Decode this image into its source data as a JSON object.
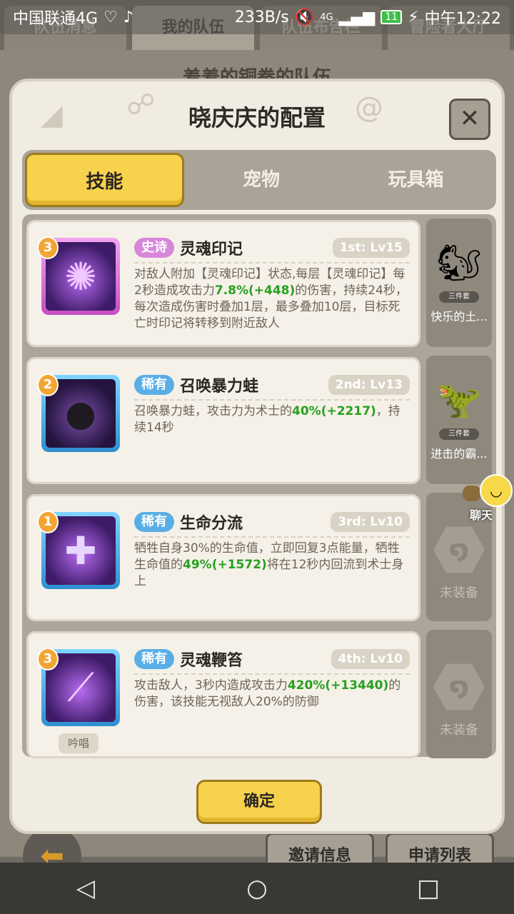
{
  "status_bar": {
    "carrier": "中国联通4G",
    "speed": "233B/s",
    "network": "4G",
    "battery": "11",
    "time": "中午12:22"
  },
  "background": {
    "tabs": [
      "队伍消息",
      "我的队伍",
      "队伍布告栏",
      "冒险者大厅"
    ],
    "team_title": "羞羞的铜拳的队伍",
    "invite_button": "邀请信息",
    "apply_button": "申请列表"
  },
  "modal": {
    "title": "晓庆庆的配置",
    "tabs": [
      "技能",
      "宠物",
      "玩具箱"
    ],
    "confirm_label": "确定",
    "skills": [
      {
        "order": "3",
        "rarity": "史诗",
        "name": "灵魂印记",
        "level": "1st: Lv15",
        "desc_a": "对敌人附加【灵魂印记】状态,每层【灵魂印记】每2秒造成攻击力",
        "g1": "7.8%(+448)",
        "desc_b": "的伤害，持续24秒，每次造成伤害时叠加1层，最多叠加10层，目标死亡时印记将转移到附近敌人"
      },
      {
        "order": "2",
        "rarity": "稀有",
        "name": "召唤暴力蛙",
        "level": "2nd: Lv13",
        "desc_a": "召唤暴力蛙，攻击力为术士的",
        "g1": "40%(+2217)",
        "desc_b": "，持续14秒"
      },
      {
        "order": "1",
        "rarity": "稀有",
        "name": "生命分流",
        "level": "3rd: Lv10",
        "desc_a": "牺牲自身30%的生命值，立即回复3点能量，牺牲生命值的",
        "g1": "49%(+1572)",
        "desc_b": "将在12秒内回流到术士身上"
      },
      {
        "order": "3",
        "rarity": "稀有",
        "name": "灵魂鞭笞",
        "level": "4th: Lv10",
        "desc_a": "攻击敌人，3秒内造成攻击力",
        "g1": "420%(+13440)",
        "desc_b": "的伤害，该技能无视敌人20%的防御",
        "chant": "吟唱"
      }
    ],
    "pets": [
      {
        "name": "快乐的土...",
        "tag": "三件套"
      },
      {
        "name": "进击的霸...",
        "tag": "三件套"
      },
      {
        "name": "未装备"
      },
      {
        "name": "未装备"
      }
    ],
    "chat_label": "聊天"
  }
}
